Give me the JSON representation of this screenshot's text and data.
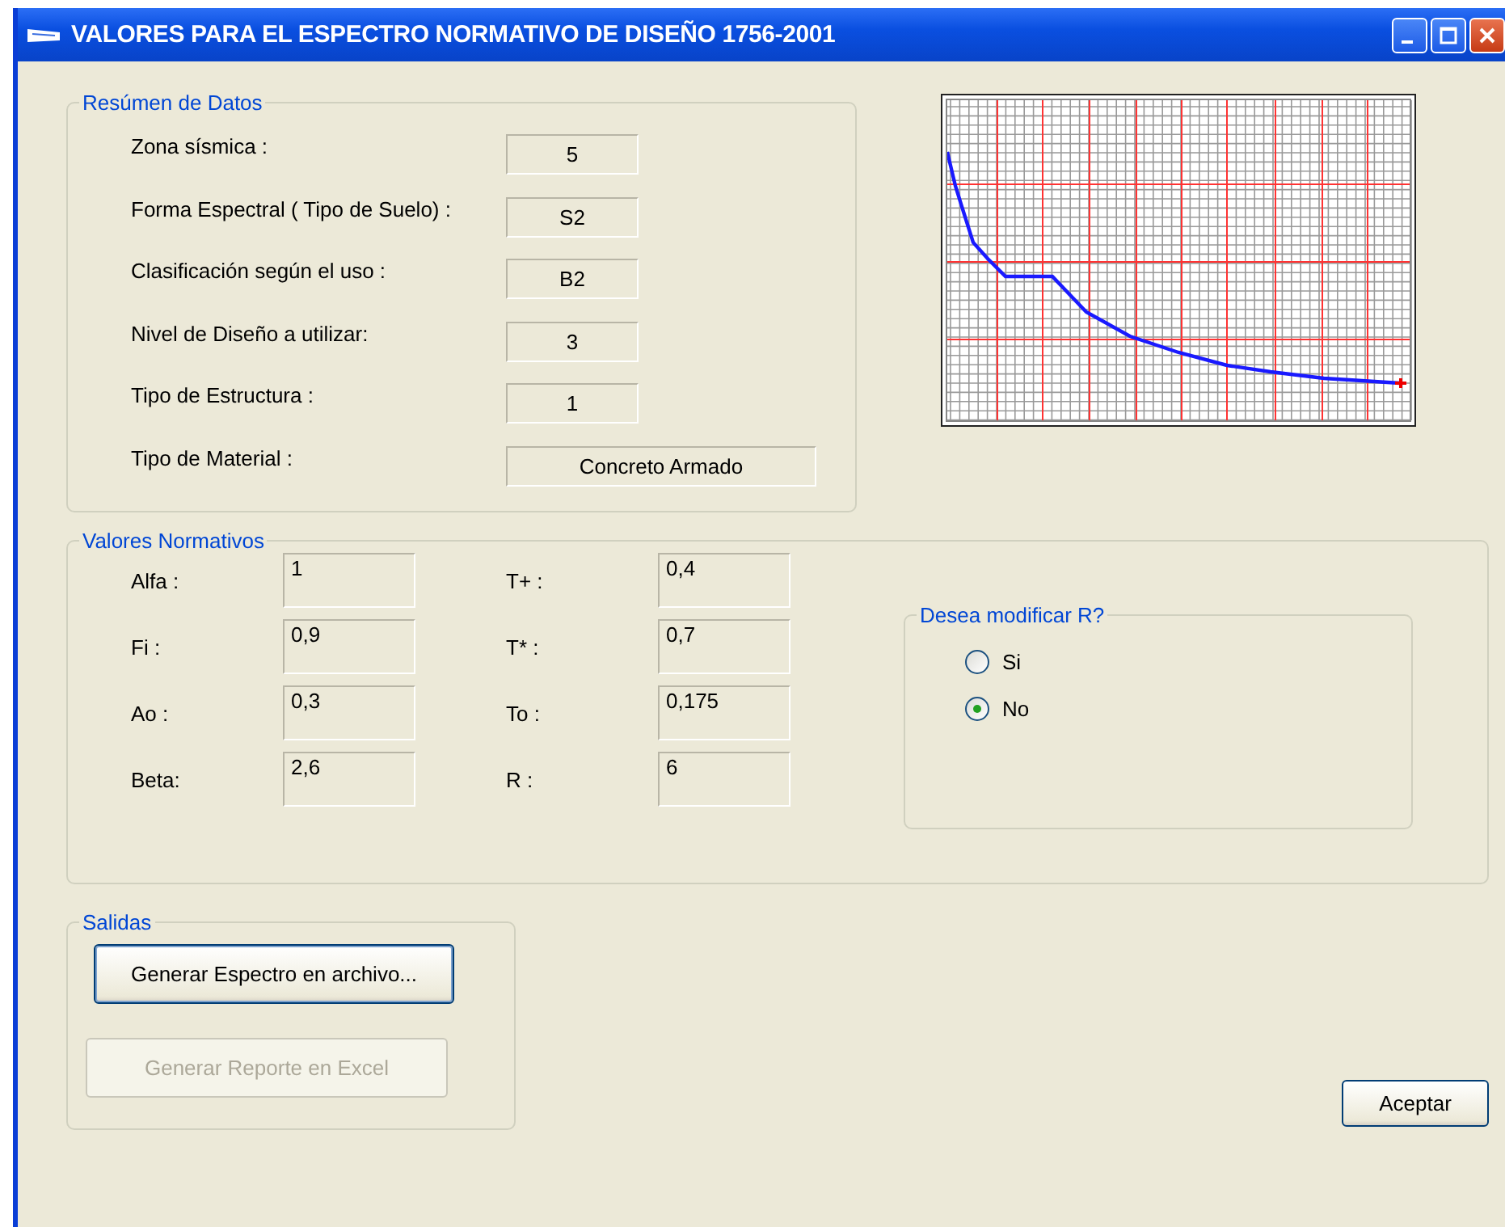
{
  "window": {
    "title": "VALORES PARA EL ESPECTRO NORMATIVO DE DISEÑO 1756-2001"
  },
  "summary": {
    "title": "Resúmen de Datos",
    "fields": [
      {
        "label": "Zona sísmica :",
        "value": "5",
        "kind": "short"
      },
      {
        "label": "Forma Espectral ( Tipo de Suelo) :",
        "value": "S2",
        "kind": "short"
      },
      {
        "label": "Clasificación según el uso :",
        "value": "B2",
        "kind": "short"
      },
      {
        "label": "Nivel de Diseño a utilizar:",
        "value": "3",
        "kind": "short"
      },
      {
        "label": "Tipo de Estructura :",
        "value": "1",
        "kind": "short"
      },
      {
        "label": "Tipo de Material :",
        "value": "Concreto Armado",
        "kind": "wide"
      }
    ]
  },
  "normative": {
    "title": "Valores Normativos",
    "columns": [
      [
        {
          "label": "Alfa :",
          "value": "1"
        },
        {
          "label": "Fi :",
          "value": "0,9"
        },
        {
          "label": "Ao :",
          "value": "0,3"
        },
        {
          "label": "Beta:",
          "value": "2,6"
        }
      ],
      [
        {
          "label": "T+ :",
          "value": "0,4"
        },
        {
          "label": "T* :",
          "value": "0,7"
        },
        {
          "label": "To :",
          "value": "0,175"
        },
        {
          "label": "R :",
          "value": "6"
        }
      ]
    ],
    "modify_r": {
      "title": "Desea modificar R?",
      "options": [
        {
          "label": "Si",
          "selected": false
        },
        {
          "label": "No",
          "selected": true
        }
      ]
    }
  },
  "outputs": {
    "title": "Salidas",
    "buttons": [
      {
        "label": "Generar Espectro en archivo...",
        "disabled": false
      },
      {
        "label": "Generar Reporte en Excel",
        "disabled": true
      }
    ]
  },
  "accept_button": "Aceptar"
}
